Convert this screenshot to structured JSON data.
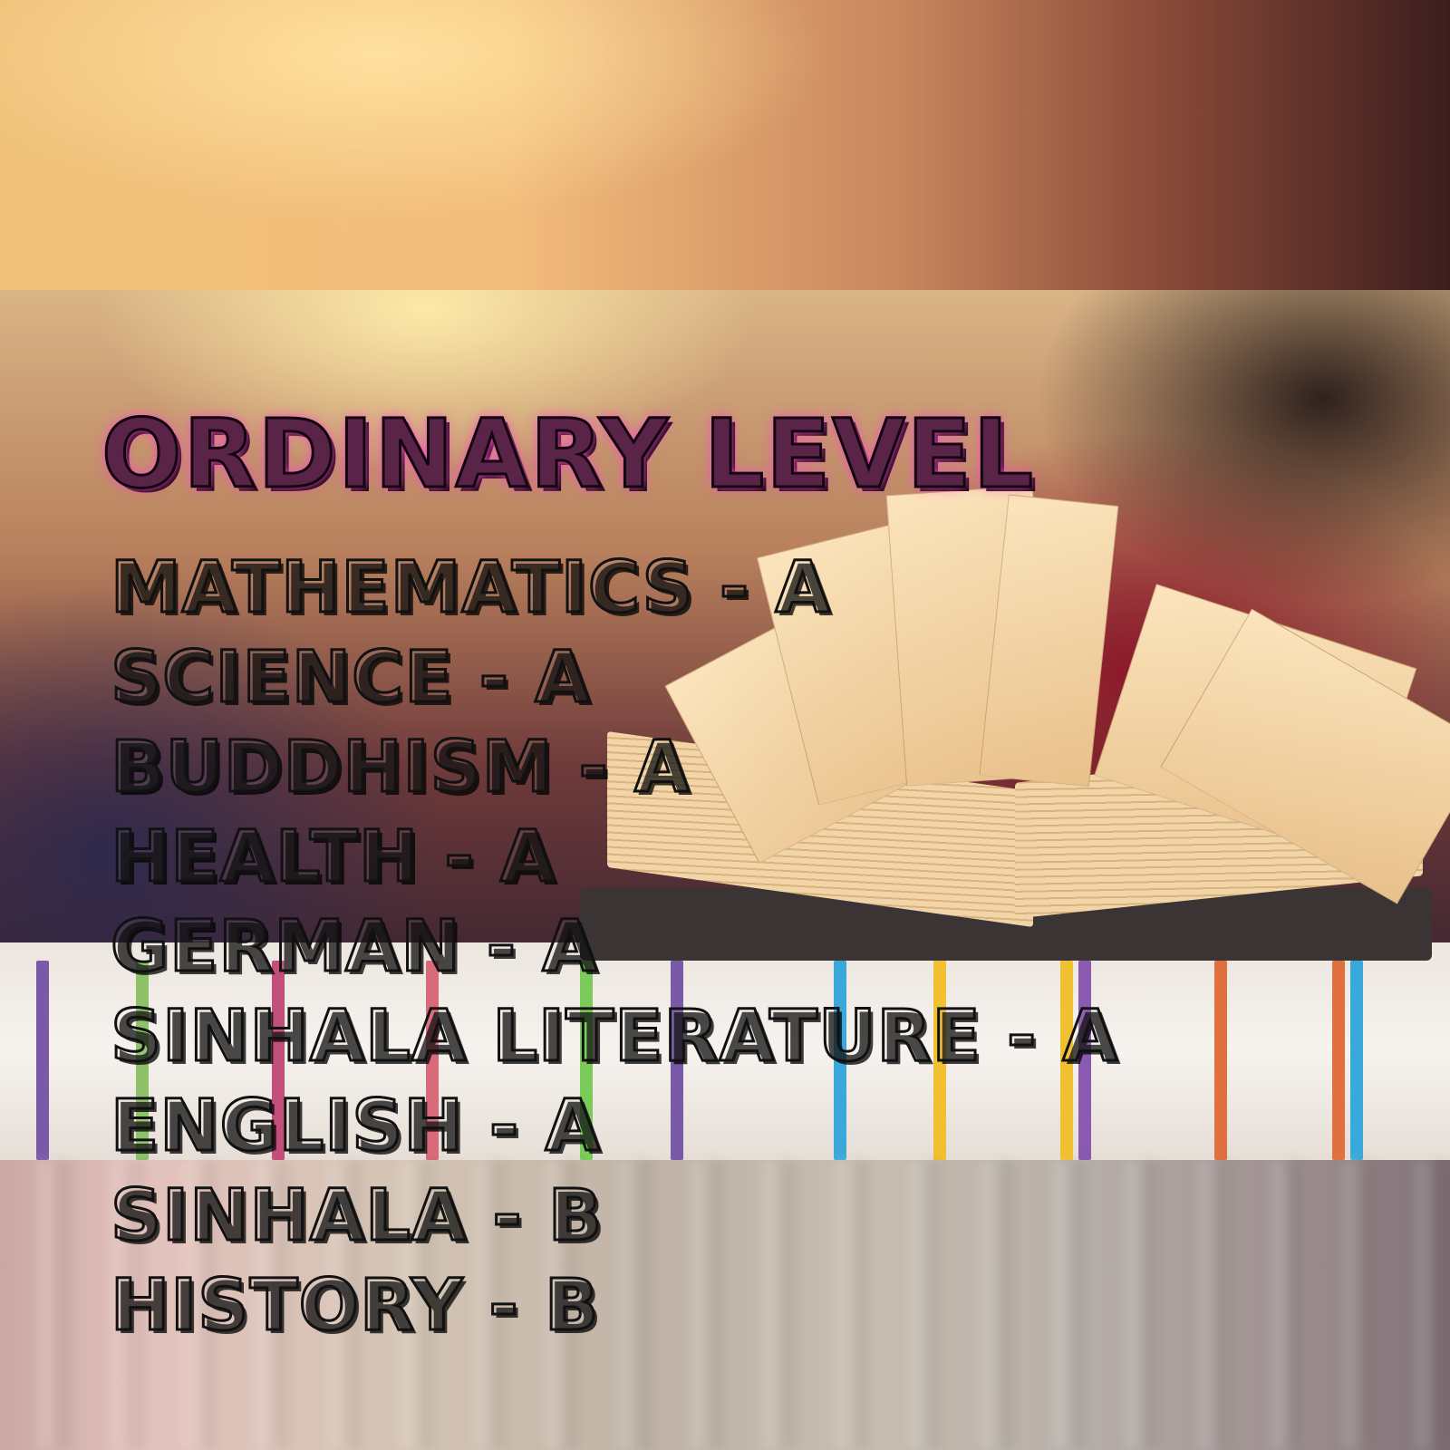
{
  "image": {
    "title": "ORDINARY LEVEL",
    "subjects": [
      "MATHEMATICS - A",
      "SCIENCE - A",
      "BUDDHISM - A",
      "HEALTH - A",
      "GERMAN - A",
      "SINHALA LITERATURE  - A",
      "ENGLISH - A",
      "SINHALA - B",
      "HISTORY - B"
    ]
  },
  "colors": {
    "title_glow": "#ff46c8",
    "text_outline": "#111111"
  }
}
